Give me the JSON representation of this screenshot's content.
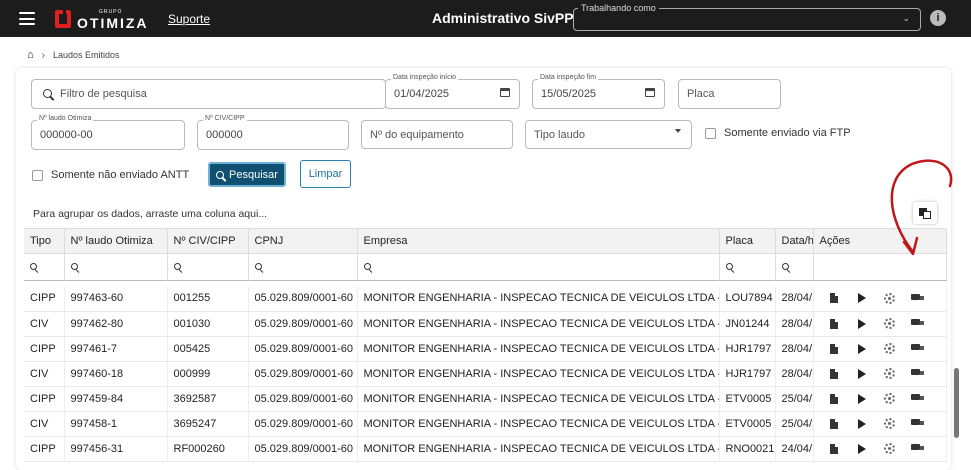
{
  "topbar": {
    "logo_grupo": "GRUPO",
    "logo_name": "OTIMIZA",
    "support_label": "Suporte",
    "title": "Administrativo SivPP",
    "working_label": "Trabalhando como",
    "working_value": "",
    "info_glyph": "i"
  },
  "breadcrumb": {
    "home_icon": "home-icon",
    "current": "Laudos Emitidos"
  },
  "filters": {
    "search_placeholder": "Filtro de pesquisa",
    "date_start_label": "Data inspeção início",
    "date_start_value": "01/04/2025",
    "date_end_label": "Data inspeção fim",
    "date_end_value": "15/05/2025",
    "placa_placeholder": "Placa",
    "laudo_label": "Nº laudo Otimiza",
    "laudo_value": "000000-00",
    "civ_label": "Nº CIV/CIPP",
    "civ_value": "000000",
    "equip_placeholder": "Nº do equipamento",
    "tipo_placeholder": "Tipo laudo",
    "ftp_label": "Somente enviado via FTP",
    "antt_label": "Somente não enviado ANTT",
    "search_button": "Pesquisar",
    "clear_button": "Limpar"
  },
  "grid": {
    "group_hint": "Para agrupar os dados, arraste uma coluna aqui...",
    "columns": [
      "Tipo",
      "Nº laudo Otimiza",
      "Nº CIV/CIPP",
      "CPNJ",
      "Empresa",
      "Placa",
      "Data/h",
      "Ações"
    ],
    "rows": [
      [
        "CIPP",
        "997463-60",
        "001255",
        "05.029.809/0001-60",
        "MONITOR ENGENHARIA - INSPECAO TECNICA DE VEICULOS LTDA - EPP",
        "LOU7894",
        "28/04/"
      ],
      [
        "CIV",
        "997462-80",
        "001030",
        "05.029.809/0001-60",
        "MONITOR ENGENHARIA - INSPECAO TECNICA DE VEICULOS LTDA - EPP",
        "JN01244",
        "28/04/"
      ],
      [
        "CIPP",
        "997461-7",
        "005425",
        "05.029.809/0001-60",
        "MONITOR ENGENHARIA - INSPECAO TECNICA DE VEICULOS LTDA - EPP",
        "HJR1797",
        "28/04/"
      ],
      [
        "CIV",
        "997460-18",
        "000999",
        "05.029.809/0001-60",
        "MONITOR ENGENHARIA - INSPECAO TECNICA DE VEICULOS LTDA - EPP",
        "HJR1797",
        "28/04/"
      ],
      [
        "CIPP",
        "997459-84",
        "3692587",
        "05.029.809/0001-60",
        "MONITOR ENGENHARIA - INSPECAO TECNICA DE VEICULOS LTDA - EPP",
        "ETV0005",
        "25/04/"
      ],
      [
        "CIV",
        "997458-1",
        "3695247",
        "05.029.809/0001-60",
        "MONITOR ENGENHARIA - INSPECAO TECNICA DE VEICULOS LTDA - EPP",
        "ETV0005",
        "25/04/"
      ],
      [
        "CIPP",
        "997456-31",
        "RF000260",
        "05.029.809/0001-60",
        "MONITOR ENGENHARIA - INSPECAO TECNICA DE VEICULOS LTDA - EPP",
        "RNO0021",
        "24/04/"
      ]
    ],
    "row_actions": [
      "document-icon",
      "play-icon",
      "gear-icon",
      "truck-icon"
    ]
  },
  "colors": {
    "topbar": "#1c1c1c",
    "primary_button": "#0f4f6f",
    "accent": "#2a7fb5",
    "annotation_arrow": "#c0171b"
  }
}
